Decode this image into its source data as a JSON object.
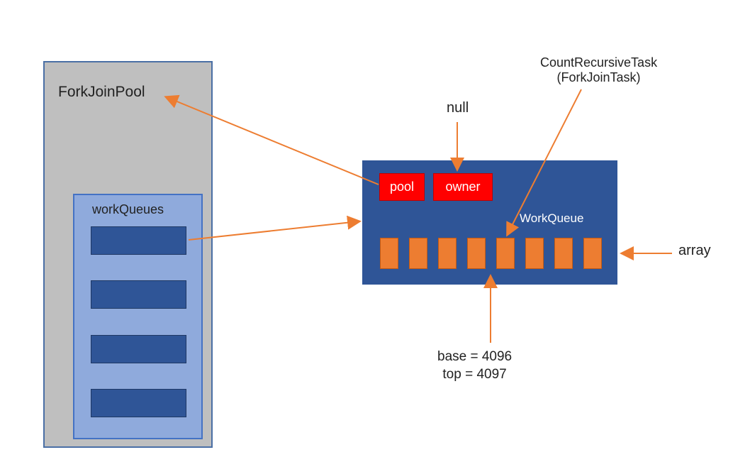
{
  "left": {
    "title": "ForkJoinPool",
    "inner_title": "workQueues",
    "slot_count": 4
  },
  "right": {
    "panel_label": "WorkQueue",
    "pool_label": "pool",
    "owner_label": "owner",
    "array_slot_count": 8
  },
  "labels": {
    "null": "null",
    "crt_line1": "CountRecursiveTask",
    "crt_line2": "(ForkJoinTask)",
    "array": "array",
    "base_line": "base = 4096",
    "top_line": "top = 4097"
  },
  "colors": {
    "arrow": "#ed7d31",
    "panel": "#2f5597",
    "red": "#ff0000",
    "outer": "#bfbfbf",
    "inner": "#8faadc"
  },
  "chart_data": {
    "type": "diagram",
    "title": "ForkJoinPool / WorkQueue structure",
    "nodes": [
      {
        "id": "forkjoinpool",
        "label": "ForkJoinPool"
      },
      {
        "id": "workqueues",
        "label": "workQueues",
        "parent": "forkjoinpool",
        "slots": 4
      },
      {
        "id": "workqueue",
        "label": "WorkQueue",
        "fields": [
          {
            "name": "pool",
            "ref": "forkjoinpool"
          },
          {
            "name": "owner",
            "value": "null"
          },
          {
            "name": "array",
            "slots": 8
          },
          {
            "name": "base",
            "value": 4096
          },
          {
            "name": "top",
            "value": 4097
          }
        ]
      },
      {
        "id": "countrecursivetask",
        "label": "CountRecursiveTask (ForkJoinTask)"
      }
    ],
    "edges": [
      {
        "from": "workqueues.slot0",
        "to": "workqueue"
      },
      {
        "from": "workqueue.pool",
        "to": "forkjoinpool"
      },
      {
        "from": "workqueue.owner",
        "to": "null"
      },
      {
        "from": "countrecursivetask",
        "to": "workqueue.array[4]"
      },
      {
        "from": "array-label",
        "to": "workqueue.array"
      },
      {
        "from": "base/top",
        "to": "workqueue.array[4]"
      }
    ]
  }
}
